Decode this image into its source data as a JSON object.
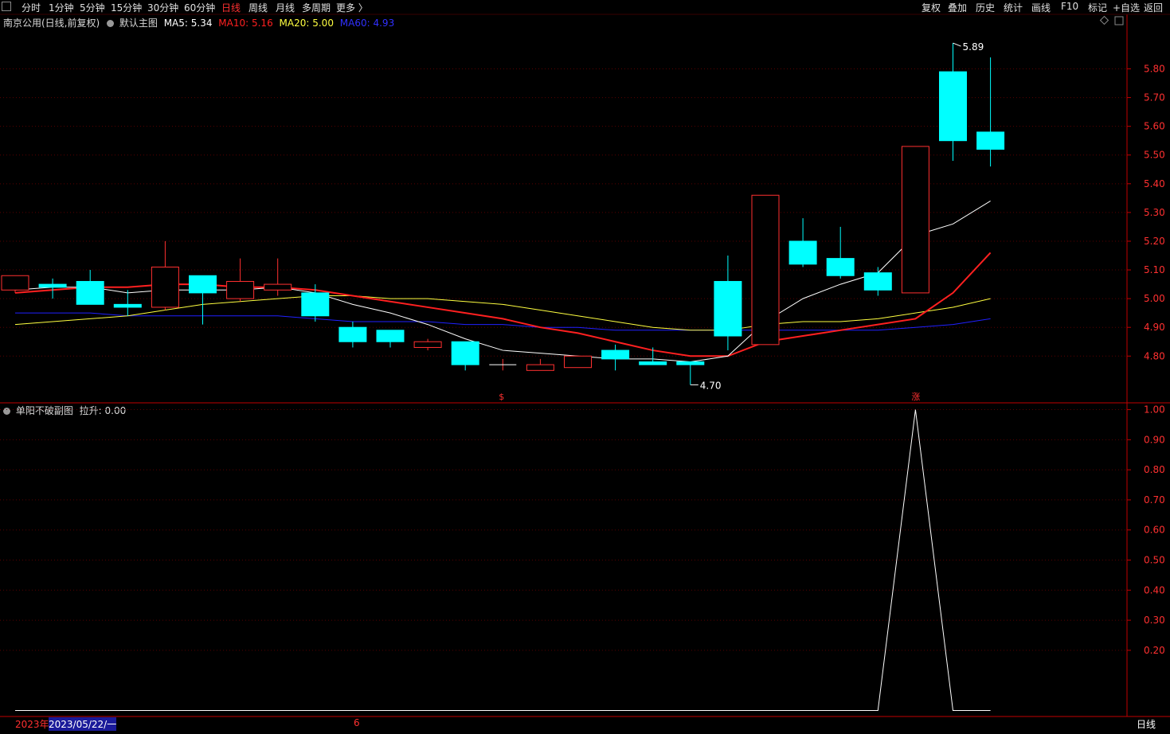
{
  "toolbar": {
    "periods": [
      "分时",
      "1分钟",
      "5分钟",
      "15分钟",
      "30分钟",
      "60分钟",
      "日线",
      "周线",
      "月线",
      "多周期",
      "更多 〉"
    ],
    "active_period": "日线",
    "right_buttons": [
      "复权",
      "叠加",
      "历史",
      "统计",
      "画线",
      "F10",
      "标记",
      "+自选",
      "返回"
    ]
  },
  "main_legend": {
    "stock": "南京公用(日线,前复权)",
    "indicator": "默认主图",
    "ma5": "MA5: 5.34",
    "ma10": "MA10: 5.16",
    "ma20": "MA20: 5.00",
    "ma60": "MA60: 4.93"
  },
  "sub_legend": {
    "name": "单阳不破副图",
    "value": "拉升: 0.00"
  },
  "colors": {
    "up": "#ff3030",
    "down": "#00ffff",
    "ma5": "#ffffff",
    "ma10": "#ff2020",
    "ma20": "#ffff40",
    "ma60": "#2020ff",
    "axis": "#c00000"
  },
  "footer": {
    "year": "2023年",
    "date": "2023/05/22/一",
    "month_mark": "6",
    "period": "日线"
  },
  "chart_data": [
    {
      "type": "candlestick",
      "y_ticks": [
        5.8,
        5.7,
        5.6,
        5.5,
        5.4,
        5.3,
        5.2,
        5.1,
        5.0,
        4.9,
        4.8
      ],
      "ylim": [
        4.64,
        5.94
      ],
      "candles": [
        {
          "o": 5.03,
          "h": 5.08,
          "l": 5.02,
          "c": 5.08
        },
        {
          "o": 5.05,
          "h": 5.07,
          "l": 5.0,
          "c": 5.04
        },
        {
          "o": 5.06,
          "h": 5.1,
          "l": 4.98,
          "c": 4.98
        },
        {
          "o": 4.98,
          "h": 5.03,
          "l": 4.94,
          "c": 4.97
        },
        {
          "o": 4.97,
          "h": 5.2,
          "l": 4.96,
          "c": 5.11
        },
        {
          "o": 5.08,
          "h": 5.08,
          "l": 4.91,
          "c": 5.02
        },
        {
          "o": 5.0,
          "h": 5.14,
          "l": 4.99,
          "c": 5.06
        },
        {
          "o": 5.03,
          "h": 5.14,
          "l": 5.01,
          "c": 5.05
        },
        {
          "o": 5.02,
          "h": 5.05,
          "l": 4.92,
          "c": 4.94
        },
        {
          "o": 4.9,
          "h": 4.92,
          "l": 4.83,
          "c": 4.85
        },
        {
          "o": 4.89,
          "h": 4.89,
          "l": 4.83,
          "c": 4.85
        },
        {
          "o": 4.83,
          "h": 4.86,
          "l": 4.82,
          "c": 4.85
        },
        {
          "o": 4.85,
          "h": 4.85,
          "l": 4.75,
          "c": 4.77
        },
        {
          "o": 4.77,
          "h": 4.79,
          "l": 4.75,
          "c": 4.77
        },
        {
          "o": 4.75,
          "h": 4.79,
          "l": 4.75,
          "c": 4.77
        },
        {
          "o": 4.76,
          "h": 4.8,
          "l": 4.76,
          "c": 4.8
        },
        {
          "o": 4.82,
          "h": 4.84,
          "l": 4.75,
          "c": 4.79
        },
        {
          "o": 4.78,
          "h": 4.83,
          "l": 4.77,
          "c": 4.77
        },
        {
          "o": 4.78,
          "h": 4.78,
          "l": 4.7,
          "c": 4.77
        },
        {
          "o": 5.06,
          "h": 5.15,
          "l": 4.82,
          "c": 4.87
        },
        {
          "o": 4.84,
          "h": 5.36,
          "l": 4.84,
          "c": 5.36
        },
        {
          "o": 5.2,
          "h": 5.28,
          "l": 5.11,
          "c": 5.12
        },
        {
          "o": 5.14,
          "h": 5.25,
          "l": 5.07,
          "c": 5.08
        },
        {
          "o": 5.09,
          "h": 5.11,
          "l": 5.01,
          "c": 5.03
        },
        {
          "o": 5.02,
          "h": 5.53,
          "l": 5.02,
          "c": 5.53
        },
        {
          "o": 5.79,
          "h": 5.89,
          "l": 5.48,
          "c": 5.55
        },
        {
          "o": 5.58,
          "h": 5.84,
          "l": 5.46,
          "c": 5.52
        }
      ],
      "ma5": [
        5.03,
        5.04,
        5.04,
        5.02,
        5.03,
        5.03,
        5.03,
        5.04,
        5.02,
        4.98,
        4.95,
        4.91,
        4.86,
        4.82,
        4.81,
        4.8,
        4.79,
        4.79,
        4.78,
        4.8,
        4.92,
        5.0,
        5.05,
        5.09,
        5.22,
        5.26,
        5.34
      ],
      "ma10": [
        5.02,
        5.03,
        5.04,
        5.04,
        5.05,
        5.05,
        5.04,
        5.04,
        5.03,
        5.01,
        4.99,
        4.97,
        4.95,
        4.93,
        4.9,
        4.88,
        4.85,
        4.82,
        4.8,
        4.8,
        4.85,
        4.87,
        4.89,
        4.91,
        4.93,
        5.02,
        5.16
      ],
      "ma20": [
        4.91,
        4.92,
        4.93,
        4.94,
        4.96,
        4.98,
        4.99,
        5.0,
        5.01,
        5.01,
        5.0,
        5.0,
        4.99,
        4.98,
        4.96,
        4.94,
        4.92,
        4.9,
        4.89,
        4.89,
        4.91,
        4.92,
        4.92,
        4.93,
        4.95,
        4.97,
        5.0
      ],
      "ma60": [
        4.95,
        4.95,
        4.95,
        4.94,
        4.94,
        4.94,
        4.94,
        4.94,
        4.93,
        4.92,
        4.92,
        4.92,
        4.91,
        4.91,
        4.9,
        4.9,
        4.89,
        4.89,
        4.89,
        4.89,
        4.89,
        4.89,
        4.89,
        4.89,
        4.9,
        4.91,
        4.93
      ],
      "high_label": "5.89",
      "low_label": "4.70",
      "markers": [
        {
          "index": 13,
          "text": "$"
        },
        {
          "index": 24,
          "text": "涨"
        }
      ]
    },
    {
      "type": "line",
      "name": "拉升",
      "y_ticks": [
        1.0,
        0.9,
        0.8,
        0.7,
        0.6,
        0.5,
        0.4,
        0.3,
        0.2
      ],
      "ylim": [
        -0.02,
        1.02
      ],
      "values": [
        0,
        0,
        0,
        0,
        0,
        0,
        0,
        0,
        0,
        0,
        0,
        0,
        0,
        0,
        0,
        0,
        0,
        0,
        0,
        0,
        0,
        0,
        0,
        0,
        1,
        0,
        0
      ]
    }
  ]
}
